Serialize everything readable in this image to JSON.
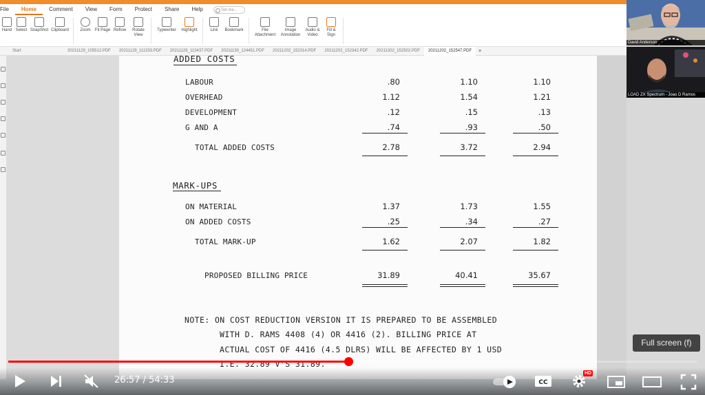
{
  "window_title": "20211202_152547.PDF - Foxit PDF Reader",
  "menu": [
    "File",
    "Home",
    "Comment",
    "View",
    "Form",
    "Protect",
    "Share",
    "Help"
  ],
  "menu_active_index": 1,
  "tell_me_placeholder": "Tell me...",
  "ribbon_tools": [
    {
      "label": "Hand",
      "icon": "hand-icon"
    },
    {
      "label": "Select",
      "icon": "select-icon"
    },
    {
      "label": "SnapShot",
      "icon": "snapshot-icon"
    },
    {
      "label": "Clipboard",
      "icon": "clipboard-icon"
    },
    {
      "label": "Zoom",
      "icon": "zoom-icon"
    },
    {
      "label": "Fit Page",
      "icon": "fit-page-icon"
    },
    {
      "label": "Reflow",
      "icon": "reflow-icon"
    },
    {
      "label": "Rotate View",
      "icon": "rotate-view-icon"
    },
    {
      "label": "Typewriter",
      "icon": "typewriter-icon"
    },
    {
      "label": "Highlight",
      "icon": "highlight-icon"
    },
    {
      "label": "Link",
      "icon": "link-icon"
    },
    {
      "label": "Bookmark",
      "icon": "bookmark-icon"
    },
    {
      "label": "File Attachment",
      "icon": "file-attachment-icon"
    },
    {
      "label": "Image Annotation",
      "icon": "image-annotation-icon"
    },
    {
      "label": "Audio & Video",
      "icon": "audio-video-icon"
    },
    {
      "label": "Fill & Sign",
      "icon": "fill-sign-icon"
    }
  ],
  "doc_tabs": [
    "Start",
    "20211129_105512.PDF",
    "20211129_111333.PDF",
    "20211129_113437.PDF",
    "20211130_124451.PDF",
    "20211202_152314.PDF",
    "20211202_152342.PDF",
    "20211202_152502.PDF",
    "20211202_152547.PDF"
  ],
  "doc_tab_active_index": 8,
  "doc_tab_close": "×",
  "pdf": {
    "added_costs_heading": "ADDED COSTS",
    "added_costs_rows": [
      {
        "label": "LABOUR",
        "values": [
          ".80",
          "1.10",
          "1.10"
        ]
      },
      {
        "label": "OVERHEAD",
        "values": [
          "1.12",
          "1.54",
          "1.21"
        ]
      },
      {
        "label": "DEVELOPMENT",
        "values": [
          ".12",
          ".15",
          ".13"
        ]
      },
      {
        "label": "G AND A",
        "values": [
          ".74",
          ".93",
          ".50"
        ]
      }
    ],
    "total_added_costs": {
      "label": "TOTAL ADDED COSTS",
      "values": [
        "2.78",
        "3.72",
        "2.94"
      ]
    },
    "markups_heading": "MARK-UPS",
    "markup_rows": [
      {
        "label": "ON MATERIAL",
        "values": [
          "1.37",
          "1.73",
          "1.55"
        ]
      },
      {
        "label": "ON ADDED COSTS",
        "values": [
          ".25",
          ".34",
          ".27"
        ]
      }
    ],
    "total_markup": {
      "label": "TOTAL MARK-UP",
      "values": [
        "1.62",
        "2.07",
        "1.82"
      ]
    },
    "billing_price": {
      "label": "PROPOSED BILLING PRICE",
      "values": [
        "31.89",
        "40.41",
        "35.67"
      ]
    },
    "note_lines": [
      "NOTE: ON COST REDUCTION VERSION IT IS PREPARED TO BE ASSEMBLED",
      "WITH D. RAMS 4408 (4) OR 4416 (2).  BILLING PRICE AT",
      "ACTUAL COST OF 4416 (4.5 DLRS) WILL BE AFFECTED BY 1 USD",
      "I.E. 32.89 V'S 31.89."
    ]
  },
  "webcams": [
    {
      "name": "David Anderson"
    },
    {
      "name": "LOAD ZX Spectrum - Joao D Ramos"
    }
  ],
  "player": {
    "current_time": "26:57",
    "duration": "54:33",
    "time_display": "26:57 / 54:33",
    "progress_fraction": 0.494,
    "fullscreen_tooltip": "Full screen (f)",
    "hd_badge": "HD",
    "accent_color": "#ff0000"
  }
}
